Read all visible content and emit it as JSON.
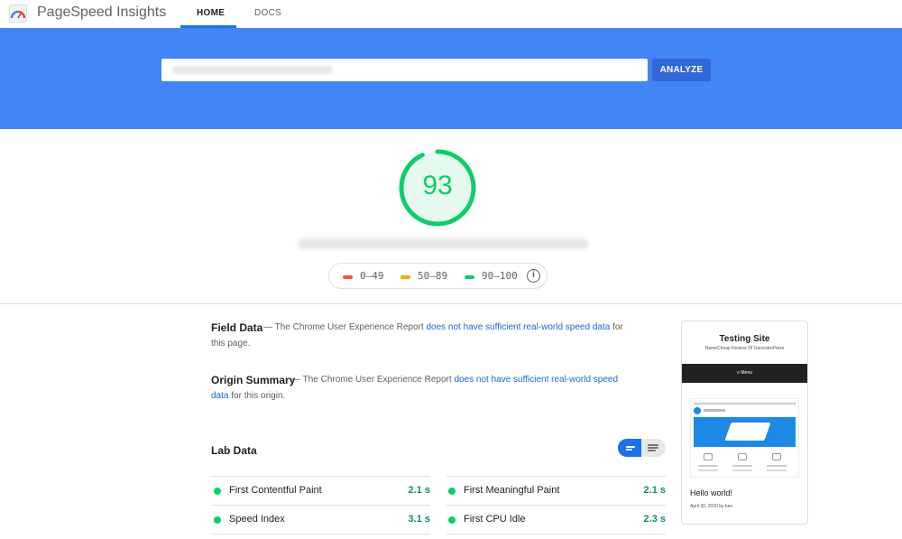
{
  "app": {
    "title": "PageSpeed Insights",
    "tabs": [
      "HOME",
      "DOCS"
    ],
    "active_tab": "HOME"
  },
  "search": {
    "url_value": "",
    "analyze_label": "ANALYZE"
  },
  "score": {
    "value": "93",
    "fraction": 0.93,
    "color": "#0cce6b"
  },
  "legend": {
    "items": [
      {
        "label": "0–49",
        "color": "#ff4e42"
      },
      {
        "label": "50–89",
        "color": "#ffa400"
      },
      {
        "label": "90–100",
        "color": "#0cce6b"
      }
    ],
    "info_icon": "info-icon"
  },
  "field_data": {
    "title": "Field Data",
    "prefix": " — The Chrome User Experience Report ",
    "link": "does not have sufficient real-world speed data",
    "suffix": " for this page."
  },
  "origin_summary": {
    "title": "Origin Summary",
    "prefix": " — The Chrome User Experience Report ",
    "link": "does not have sufficient real-world speed data",
    "suffix": " for this origin."
  },
  "lab_data": {
    "title": "Lab Data",
    "metrics": [
      {
        "label": "First Contentful Paint",
        "value": "2.1 s"
      },
      {
        "label": "First Meaningful Paint",
        "value": "2.1 s"
      },
      {
        "label": "Speed Index",
        "value": "3.1 s"
      },
      {
        "label": "First CPU Idle",
        "value": "2.3 s"
      }
    ]
  },
  "preview": {
    "site_title": "Testing Site",
    "tagline": "NameCheap Review Of GeneratePress",
    "menu": "≡ Menu",
    "post_title": "Hello world!",
    "post_meta": "April 30, 2020 by ben"
  }
}
